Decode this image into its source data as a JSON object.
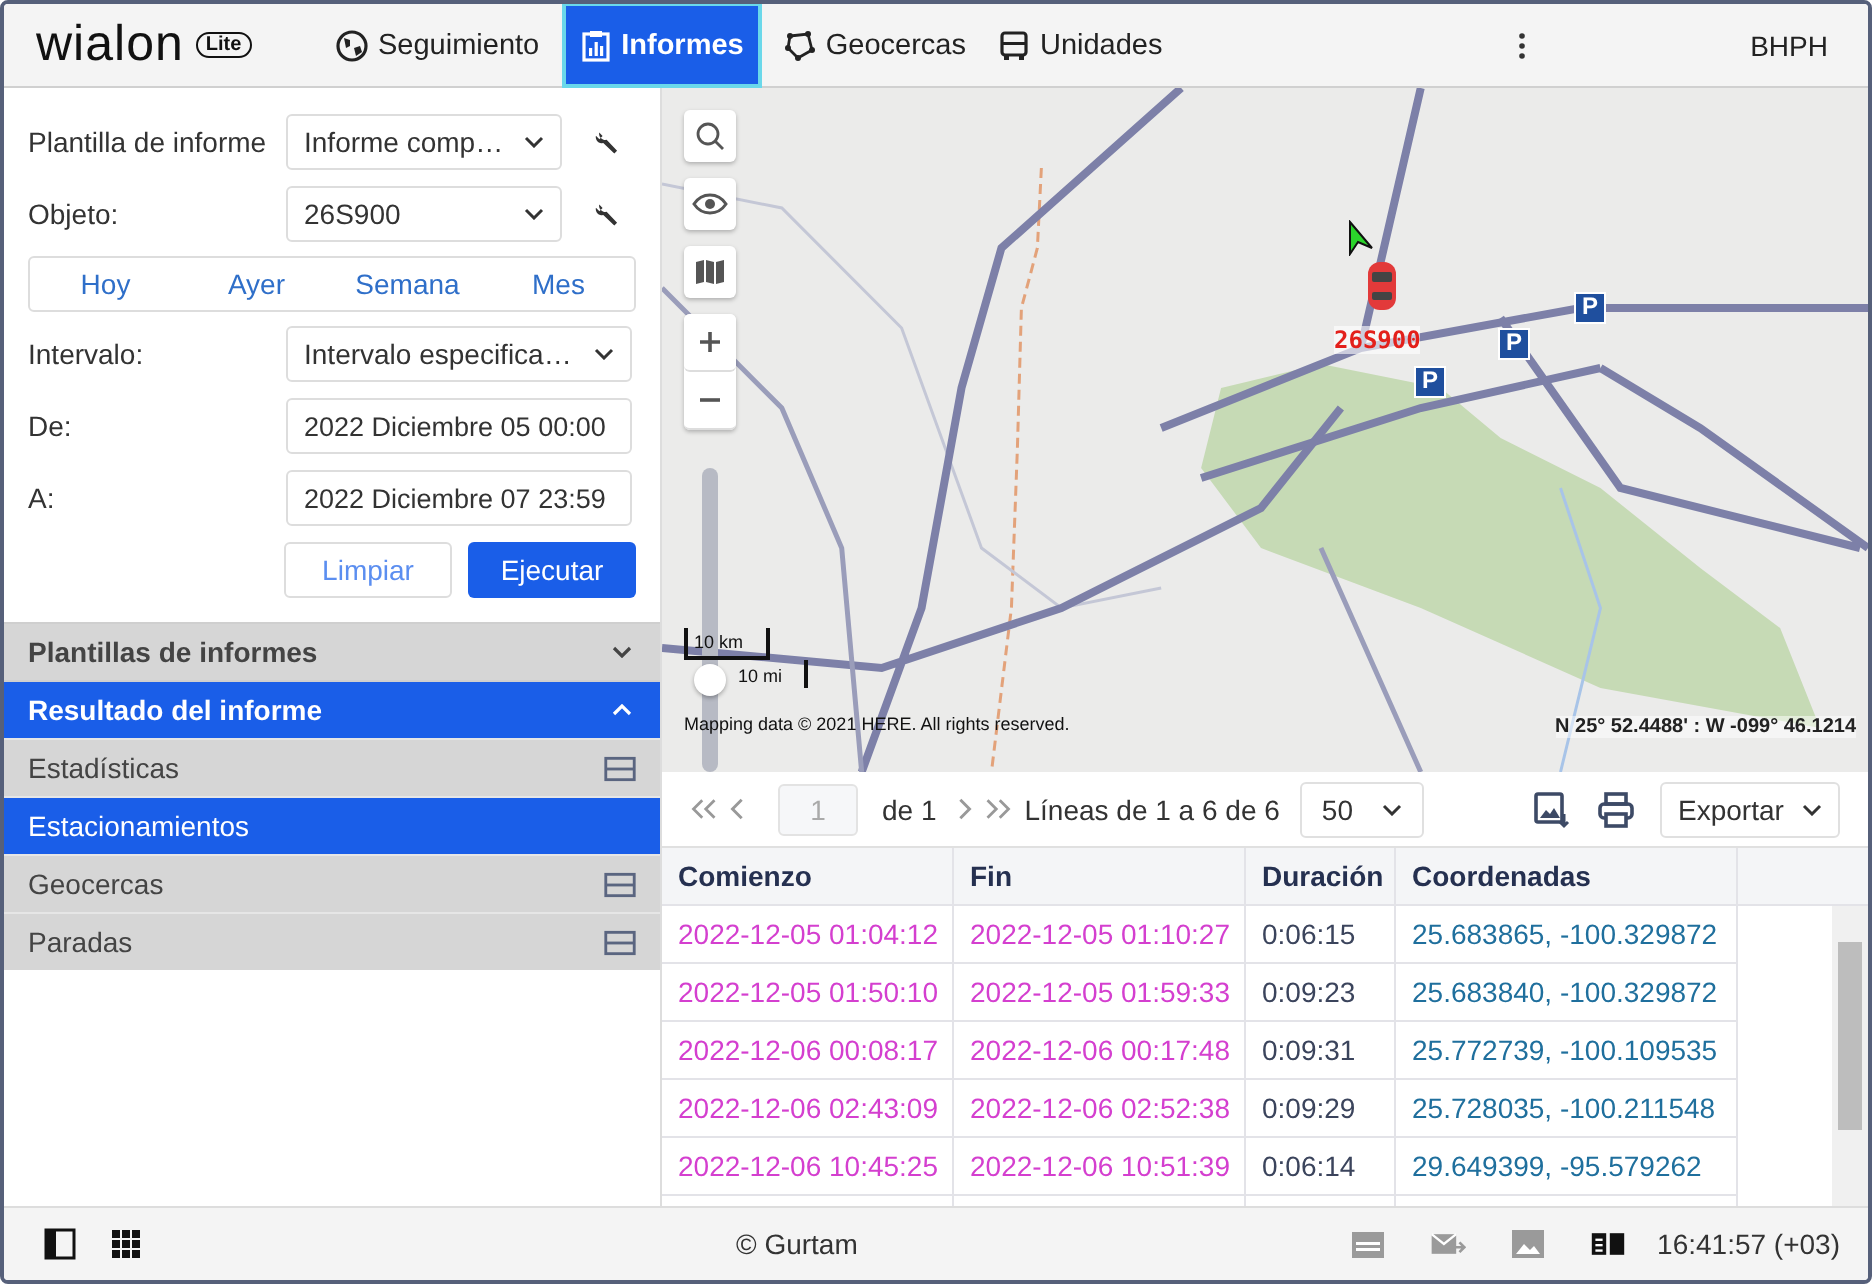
{
  "header": {
    "logo": "wialon",
    "logo_badge": "Lite",
    "user": "BHPH",
    "nav": [
      {
        "label": "Seguimiento",
        "selected": false
      },
      {
        "label": "Informes",
        "selected": true
      },
      {
        "label": "Geocercas",
        "selected": false
      },
      {
        "label": "Unidades",
        "selected": false
      }
    ]
  },
  "report_form": {
    "fields": [
      {
        "label": "Plantilla de informe",
        "value": "Informe comp…",
        "kind": "select",
        "tool": true
      },
      {
        "label": "Objeto:",
        "value": "26S900",
        "kind": "select",
        "tool": true
      },
      {
        "kind": "ranges",
        "options": [
          "Hoy",
          "Ayer",
          "Semana",
          "Mes"
        ]
      },
      {
        "label": "Intervalo:",
        "value": "Intervalo especifica…",
        "kind": "select",
        "tool": false
      },
      {
        "label": "De:",
        "value": "2022 Diciembre 05 00:00",
        "kind": "input",
        "tool": false
      },
      {
        "label": "A:",
        "value": "2022 Diciembre 07 23:59",
        "kind": "input",
        "tool": false
      }
    ],
    "buttons": [
      {
        "label": "Limpiar",
        "kind": "secondary"
      },
      {
        "label": "Ejecutar",
        "kind": "primary"
      }
    ]
  },
  "sections": [
    {
      "title": "Plantillas de informes",
      "expanded": false
    },
    {
      "title": "Resultado del informe",
      "expanded": true
    }
  ],
  "result_items": [
    {
      "label": "Estadísticas",
      "selected": false,
      "table_icon": true
    },
    {
      "label": "Estacionamientos",
      "selected": true,
      "table_icon": false
    },
    {
      "label": "Geocercas",
      "selected": false,
      "table_icon": true
    },
    {
      "label": "Paradas",
      "selected": false,
      "table_icon": true
    }
  ],
  "map": {
    "unit_label": "26S900",
    "parking_markers": [
      "P",
      "P",
      "P"
    ],
    "zoom": {
      "level": 0.3
    },
    "scale": [
      "10 km",
      "10 mi"
    ],
    "attribution": "Mapping data © 2021 HERE. All rights reserved.",
    "coordinates": "N 25° 52.4488' : W -099° 46.1214"
  },
  "pager": {
    "page": "1",
    "of": "de 1",
    "lines": "Líneas de 1 a 6 de 6",
    "page_size": "50",
    "export": "Exportar"
  },
  "table": {
    "columns": [
      "Comienzo",
      "Fin",
      "Duración",
      "Coordenadas"
    ],
    "rows": [
      [
        "2022-12-05 01:04:12",
        "2022-12-05 01:10:27",
        "0:06:15",
        "25.683865, -100.329872"
      ],
      [
        "2022-12-05 01:50:10",
        "2022-12-05 01:59:33",
        "0:09:23",
        "25.683840, -100.329872"
      ],
      [
        "2022-12-06 00:08:17",
        "2022-12-06 00:17:48",
        "0:09:31",
        "25.772739, -100.109535"
      ],
      [
        "2022-12-06 02:43:09",
        "2022-12-06 02:52:38",
        "0:09:29",
        "25.728035, -100.211548"
      ],
      [
        "2022-12-06 10:45:25",
        "2022-12-06 10:51:39",
        "0:06:14",
        "29.649399, -95.579262"
      ]
    ]
  },
  "status_bar": {
    "copyright": "© Gurtam",
    "time": "16:41:57 (+03)"
  }
}
